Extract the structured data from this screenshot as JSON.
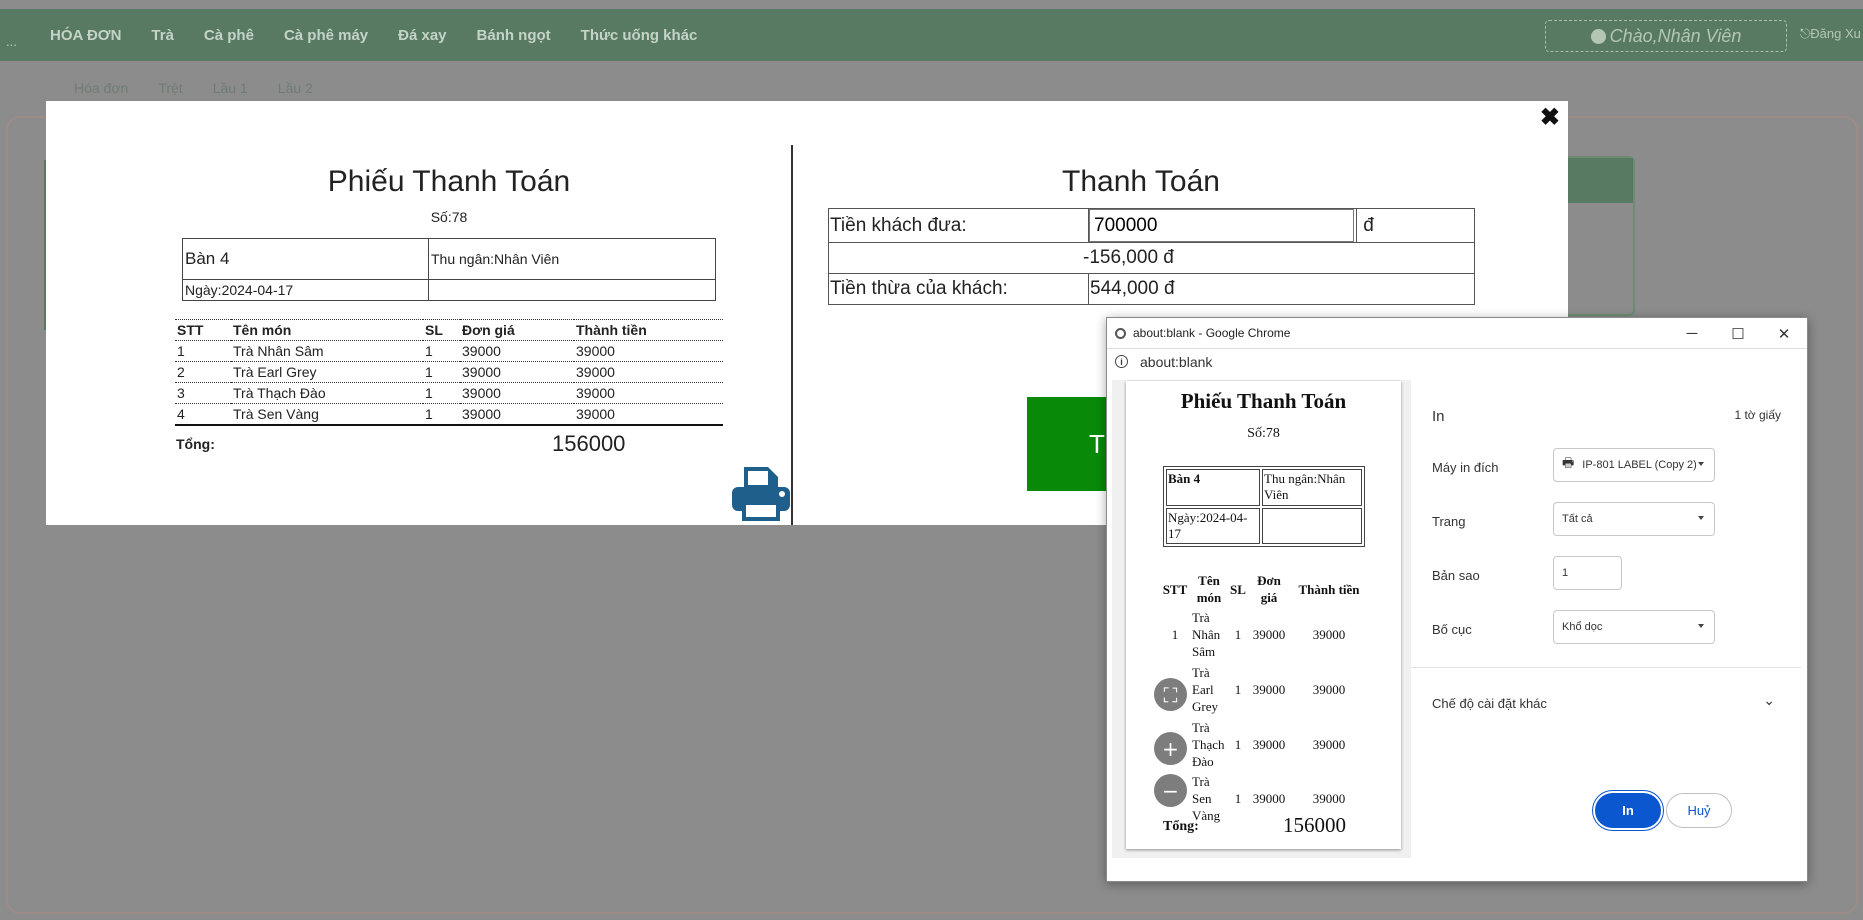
{
  "app": {
    "menu_dots": "...",
    "nav": [
      "HÓA ĐƠN",
      "Trà",
      "Cà phê",
      "Cà phê máy",
      "Đá xay",
      "Bánh ngọt",
      "Thức uống khác"
    ],
    "greeting": "Chào,Nhân Viên",
    "logout": "Đăng Xu",
    "subnav": [
      "Hóa đơn",
      "Trệt",
      "Lầu 1",
      "Lầu 2"
    ]
  },
  "modal": {
    "close": "✖",
    "receipt": {
      "title": "Phiếu Thanh Toán",
      "number": "Số:78",
      "table": "Bàn 4",
      "cashier": "Thu ngân:Nhân Viên",
      "date": "Ngày:2024-04-17",
      "headers": [
        "STT",
        "Tên món",
        "SL",
        "Đơn giá",
        "Thành tiền"
      ],
      "items": [
        [
          "1",
          "Trà Nhân Sâm",
          "1",
          "39000",
          "39000"
        ],
        [
          "2",
          "Trà Earl Grey",
          "1",
          "39000",
          "39000"
        ],
        [
          "3",
          "Trà Thạch Đào",
          "1",
          "39000",
          "39000"
        ],
        [
          "4",
          "Trà Sen Vàng",
          "1",
          "39000",
          "39000"
        ]
      ],
      "total_label": "Tổng:",
      "total": "156000"
    },
    "payment": {
      "title": "Thanh Toán",
      "given_label": "Tiền khách đưa:",
      "given_value": "700000",
      "currency": "đ",
      "diff": "-156,000 đ",
      "change_label": "Tiền thừa của khách:",
      "change": "544,000 đ",
      "button_partial": "T"
    }
  },
  "print_window": {
    "title": "about:blank - Google Chrome",
    "address": "about:blank",
    "preview": {
      "title": "Phiếu Thanh Toán",
      "number": "Số:78",
      "table": "Bàn 4",
      "cashier": "Thu ngân:Nhân Viên",
      "date": "Ngày:2024-04-17",
      "headers": [
        "STT",
        "Tên món",
        "SL",
        "Đơn giá",
        "Thành tiền"
      ],
      "items": [
        [
          "1",
          "Trà Nhân Sâm",
          "1",
          "39000",
          "39000"
        ],
        [
          "",
          "Trà Earl Grey",
          "1",
          "39000",
          "39000"
        ],
        [
          "",
          "Trà Thạch Đào",
          "1",
          "39000",
          "39000"
        ],
        [
          "",
          "Trà Sen Vàng",
          "1",
          "39000",
          "39000"
        ]
      ],
      "total_label": "Tổng:",
      "total": "156000"
    },
    "settings": {
      "heading": "In",
      "sheets": "1 tờ giấy",
      "printer_label": "Máy in đích",
      "printer": "IP-801 LABEL (Copy 2)",
      "pages_label": "Trang",
      "pages": "Tất cả",
      "copies_label": "Bản sao",
      "copies": "1",
      "layout_label": "Bố cục",
      "layout": "Khổ dọc",
      "more_label": "Chế độ cài đặt khác",
      "print_button": "In",
      "cancel_button": "Huỷ"
    }
  }
}
